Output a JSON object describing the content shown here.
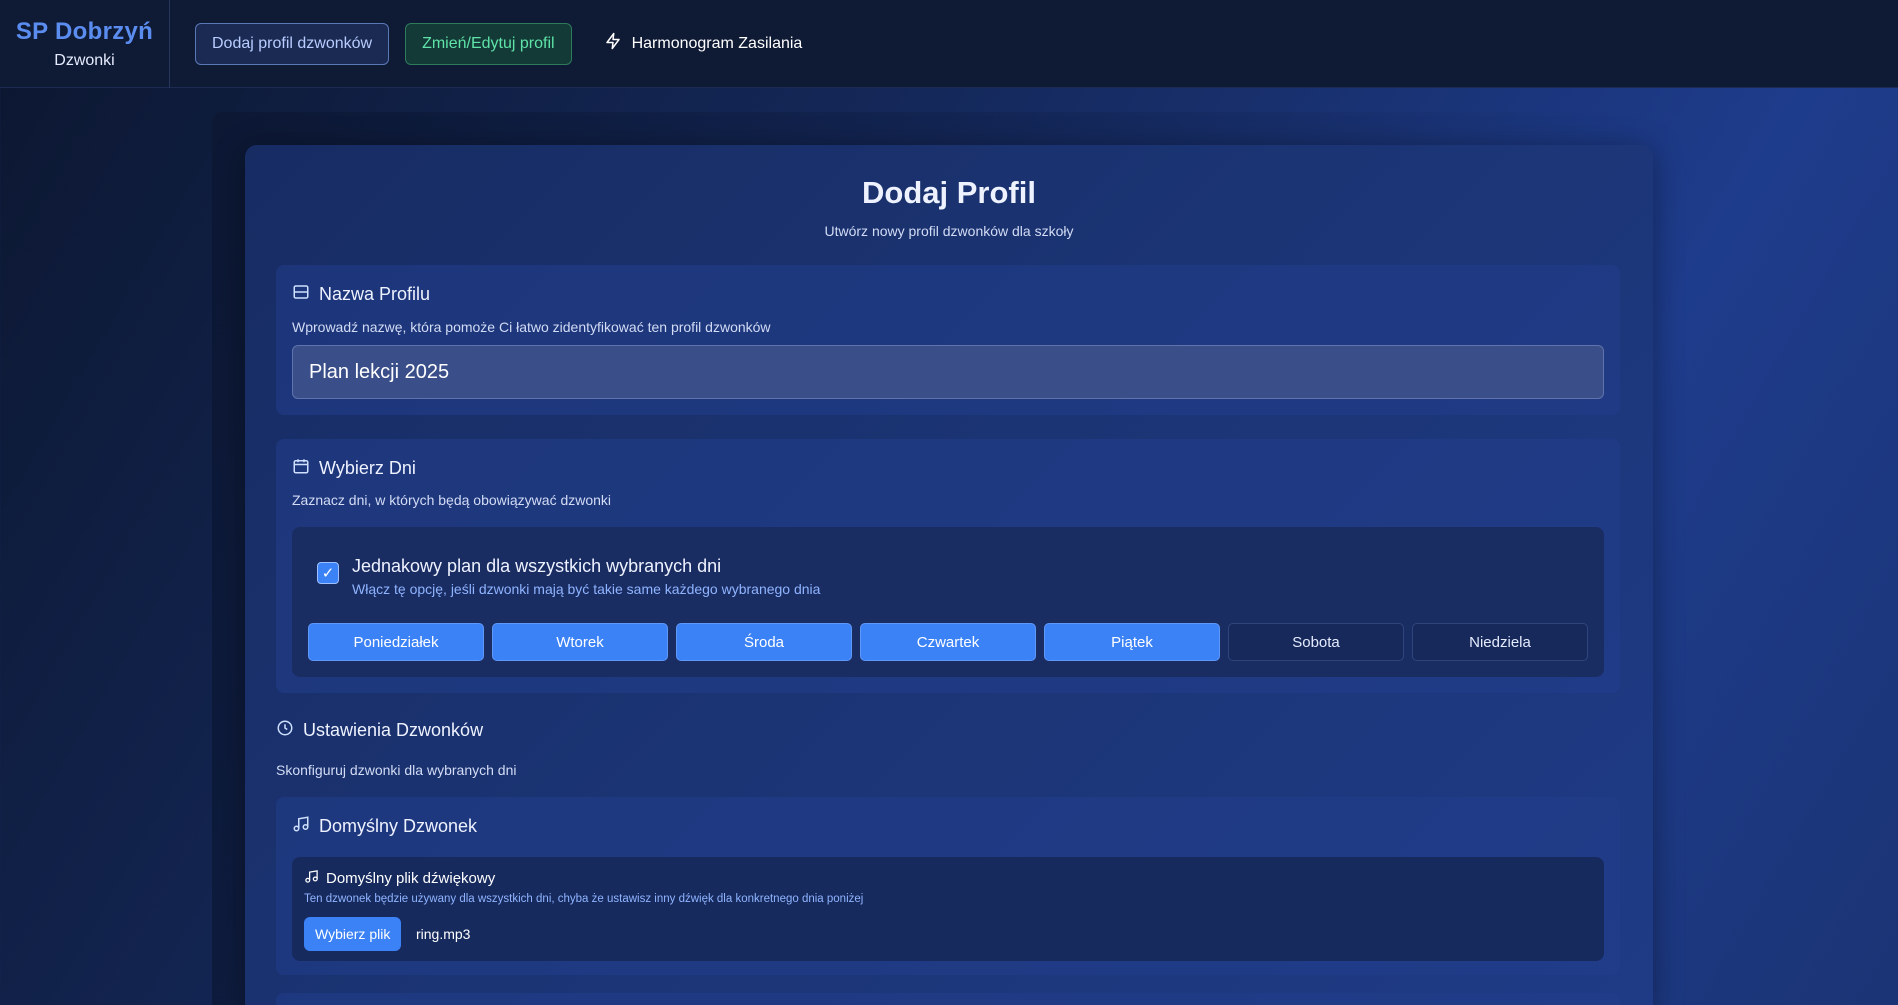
{
  "brand": {
    "title": "SP Dobrzyń",
    "subtitle": "Dzwonki"
  },
  "nav": {
    "add_profile": "Dodaj profil dzwonków",
    "edit_profile": "Zmień/Edytuj profil",
    "power_schedule": "Harmonogram Zasilania"
  },
  "page": {
    "title": "Dodaj Profil",
    "subtitle": "Utwórz nowy profil dzwonków dla szkoły"
  },
  "profile_name": {
    "heading": "Nazwa Profilu",
    "description": "Wprowadź nazwę, która pomoże Ci łatwo zidentyfikować ten profil dzwonków",
    "value": "Plan lekcji 2025"
  },
  "days": {
    "heading": "Wybierz Dni",
    "description": "Zaznacz dni, w których będą obowiązywać dzwonki",
    "same_plan_title": "Jednakowy plan dla wszystkich wybranych dni",
    "same_plan_desc": "Włącz tę opcję, jeśli dzwonki mają być takie same każdego wybranego dnia",
    "same_plan_checked": true,
    "items": [
      {
        "label": "Poniedziałek",
        "selected": true
      },
      {
        "label": "Wtorek",
        "selected": true
      },
      {
        "label": "Środa",
        "selected": true
      },
      {
        "label": "Czwartek",
        "selected": true
      },
      {
        "label": "Piątek",
        "selected": true
      },
      {
        "label": "Sobota",
        "selected": false
      },
      {
        "label": "Niedziela",
        "selected": false
      }
    ]
  },
  "bell_settings": {
    "heading": "Ustawienia Dzwonków",
    "description": "Skonfiguruj dzwonki dla wybranych dni"
  },
  "default_bell": {
    "heading": "Domyślny Dzwonek",
    "file_title": "Domyślny plik dźwiękowy",
    "file_desc": "Ten dzwonek będzie używany dla wszystkich dni, chyba że ustawisz inny dźwięk dla konkretnego dnia poniżej",
    "choose_label": "Wybierz plik",
    "file_name": "ring.mp3"
  },
  "colors": {
    "accent": "#3b82f6",
    "brand": "#5b8df0",
    "success": "#5fe3a8"
  }
}
